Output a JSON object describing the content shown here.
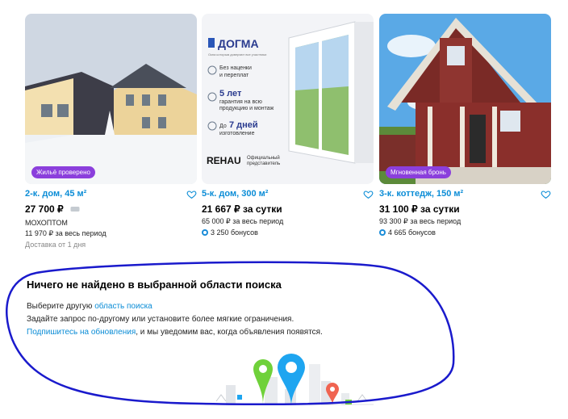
{
  "cards": [
    {
      "badge": "Жильё проверено",
      "badge_color": "#8b3fdc",
      "title": "2-к. дом, 45 м²",
      "price": "27 700 ₽",
      "line1": "МОХОПТОМ",
      "line2": "11 970 ₽ за весь период",
      "line3": "Доставка от 1 дня"
    },
    {
      "title": "5-к. дом, 300 м²",
      "price": "21 667 ₽ за сутки",
      "line1": "65 000 ₽ за весь период",
      "bonus": "3 250 бонусов",
      "ad": {
        "brand": "ДОГМА",
        "tagline": "Окна которым доверяют все участники",
        "f1": "Без наценки",
        "f1b": "и переплат",
        "f2": "5 лет",
        "f2b": "гарантия на всю",
        "f2c": "продукцию и монтаж",
        "f3": "До",
        "f3b": "7 дней",
        "f3c": "изготовление",
        "rehau": "REHAU",
        "rep": "Официальный",
        "rep2": "представитель"
      }
    },
    {
      "badge": "Мгновенная бронь",
      "badge_color": "#8b3fdc",
      "title": "3-к. коттедж, 150 м²",
      "price": "31 100 ₽ за сутки",
      "line1": "93 300 ₽ за весь период",
      "bonus": "4 665 бонусов"
    }
  ],
  "empty": {
    "heading": "Ничего не найдено в выбранной области поиска",
    "p1_text": "Выберите другую ",
    "p1_link": "область поиска",
    "p2": "Задайте запрос по-другому или установите более мягкие ограничения.",
    "p3_link": "Подпишитесь на обновления",
    "p3_text": ", и мы уведомим вас, когда объявления появятся."
  },
  "colors": {
    "link": "#0a8cd6",
    "annotation": "#1a1acc",
    "pin_green": "#6fd13a",
    "pin_blue": "#1ea5f0",
    "pin_red": "#f06451"
  },
  "icons": [
    "heart-icon",
    "car-plate-icon",
    "bonus-icon",
    "location-pin-icon"
  ]
}
